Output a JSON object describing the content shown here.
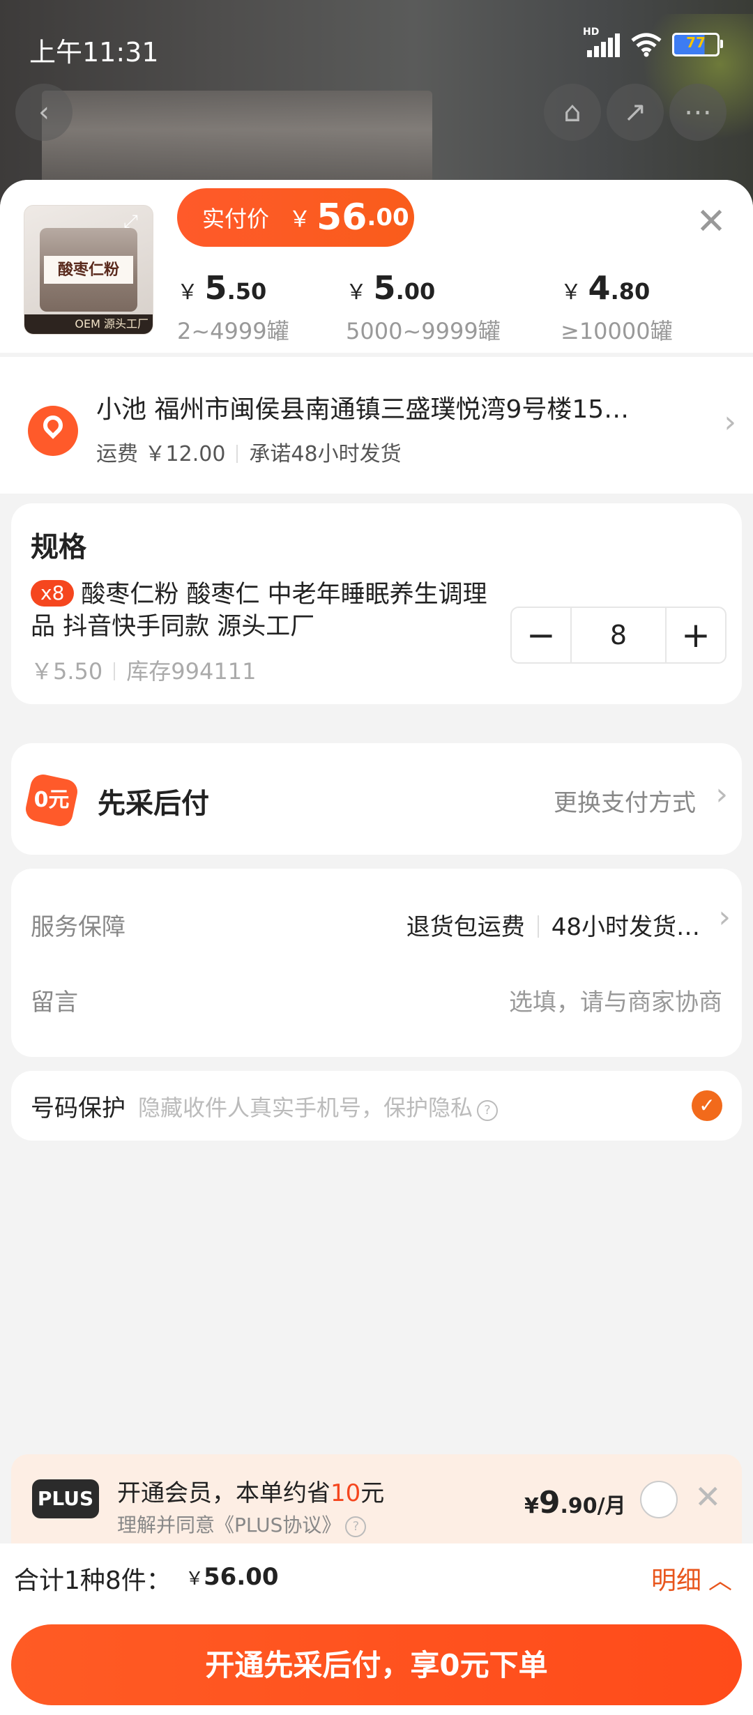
{
  "status_bar": {
    "time": "上午11:31",
    "network": "HD",
    "battery": "77"
  },
  "header": {
    "actual_price_label": "实付价",
    "currency": "￥",
    "actual_price_int": "56",
    "actual_price_dec": ".00",
    "tiers": [
      {
        "currency": "￥",
        "int": "5",
        "dec": ".50",
        "range": "2~4999罐"
      },
      {
        "currency": "￥",
        "int": "5",
        "dec": ".00",
        "range": "5000~9999罐"
      },
      {
        "currency": "￥",
        "int": "4",
        "dec": ".80",
        "range": "≥10000罐"
      }
    ],
    "thumb_label": "酸枣仁粉",
    "thumb_tag": "OEM 源头工厂"
  },
  "address": {
    "line": "小池 福州市闽侯县南通镇三盛璞悦湾9号楼15…",
    "shipping_fee": "运费 ￥12.00",
    "promise": "承诺48小时发货"
  },
  "spec": {
    "title": "规格",
    "qty_badge": "x8",
    "name": "酸枣仁粉 酸枣仁 中老年睡眠养生调理品 抖音快手同款 源头工厂",
    "unit_price": "￥5.50",
    "stock": "库存994111",
    "quantity": "8"
  },
  "payment": {
    "icon_text": "0元",
    "title": "先采后付",
    "change_label": "更换支付方式"
  },
  "service": {
    "label": "服务保障",
    "item1": "退货包运费",
    "item2": "48小时发货…",
    "note_label": "留言",
    "note_placeholder": "选填，请与商家协商"
  },
  "protection": {
    "label": "号码保护",
    "hint": "隐藏收件人真实手机号，保护隐私",
    "checked": true
  },
  "plus": {
    "logo": "PLUS",
    "text_pre": "开通会员，本单约省",
    "save_amount": "10",
    "text_post": "元",
    "agreement": "理解并同意《PLUS协议》",
    "price_cur": "¥",
    "price_int": "9",
    "price_rest": ".90/月"
  },
  "summary": {
    "total_label": "合计1种8件：",
    "total_cur": "￥",
    "total_amount": "56.00",
    "detail_label": "明细"
  },
  "cta": {
    "label": "开通先采后付，享0元下单"
  },
  "colors": {
    "accent": "#ff5a2a",
    "cta": "#ff4b1a",
    "plus_bg": "#fdeee4"
  }
}
